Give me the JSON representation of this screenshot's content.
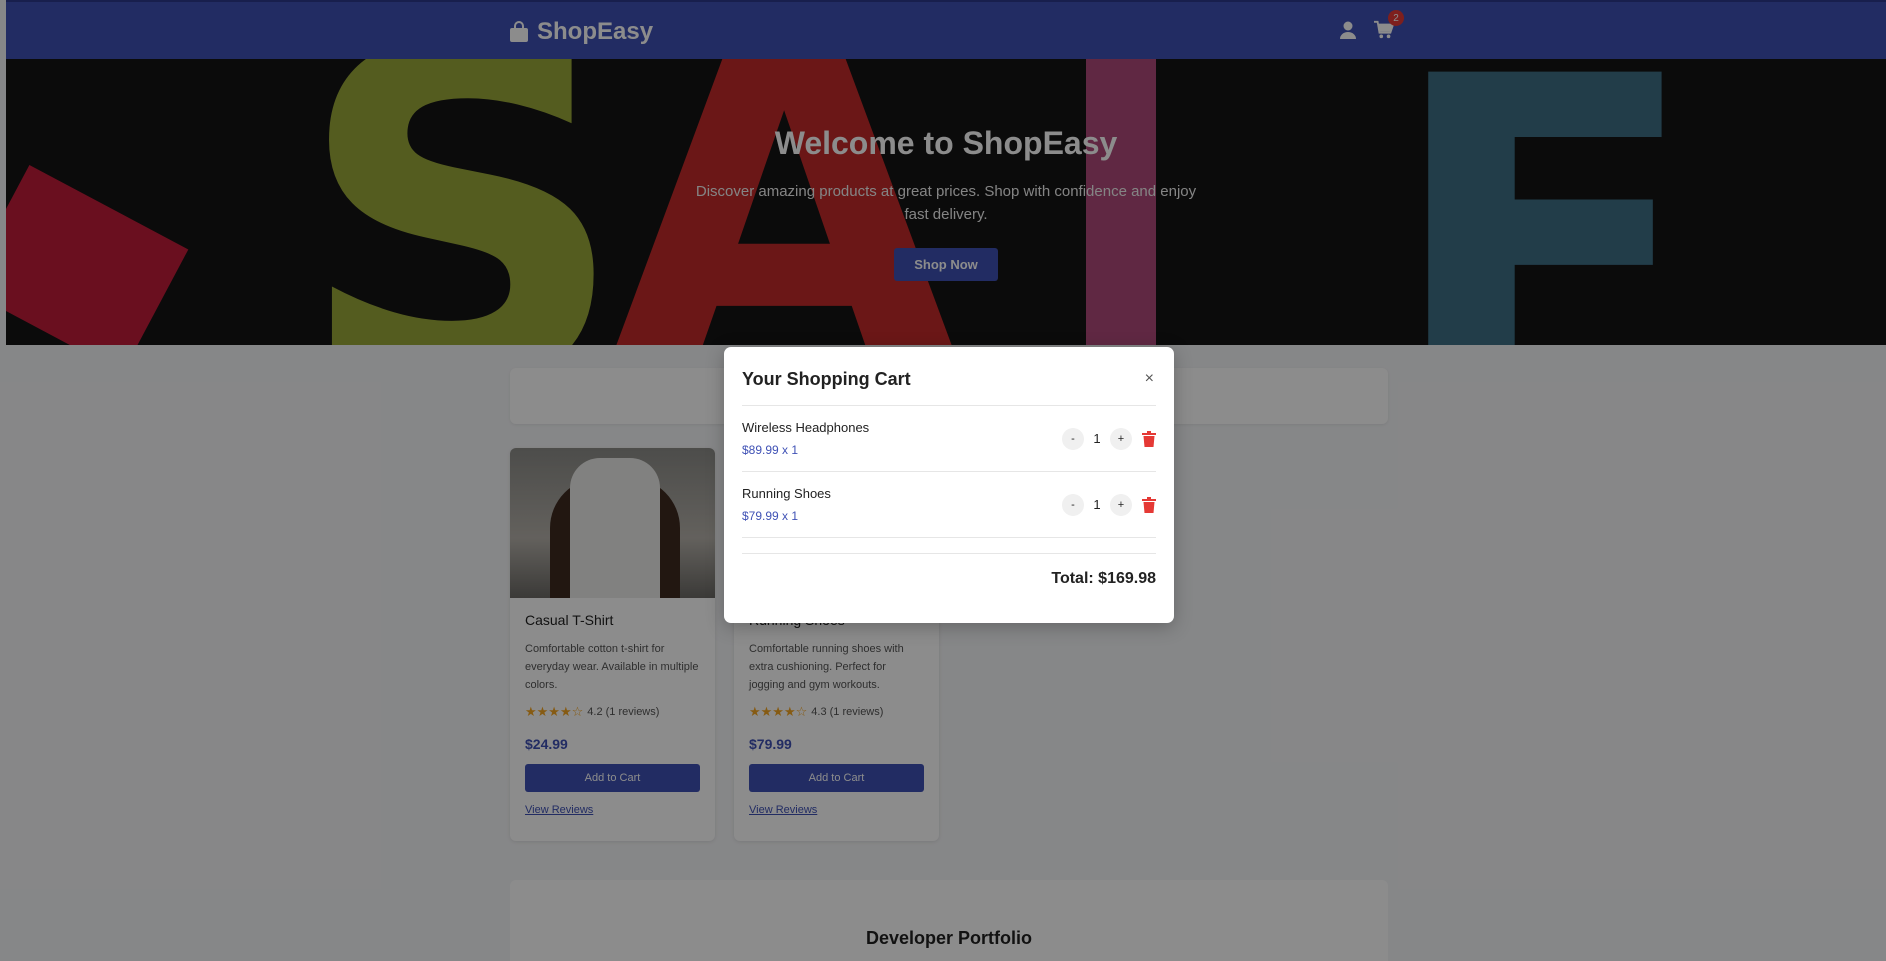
{
  "header": {
    "brand": "ShopEasy",
    "cart_count": "2"
  },
  "hero": {
    "title": "Welcome to ShopEasy",
    "subtitle": "Discover amazing products at great prices. Shop with confidence and enjoy fast delivery.",
    "cta_label": "Shop Now"
  },
  "products": [
    {
      "title": "Casual T-Shirt",
      "description": "Comfortable cotton t-shirt for everyday wear. Available in multiple colors.",
      "rating": "4.2 (1 reviews)",
      "price": "$24.99",
      "add_label": "Add to Cart",
      "reviews_label": "View Reviews"
    },
    {
      "title": "Running Shoes",
      "description": "Comfortable running shoes with extra cushioning. Perfect for jogging and gym workouts.",
      "rating": "4.3 (1 reviews)",
      "price": "$79.99",
      "add_label": "Add to Cart",
      "reviews_label": "View Reviews"
    }
  ],
  "portfolio": {
    "title": "Developer Portfolio"
  },
  "cart_modal": {
    "title": "Your Shopping Cart",
    "close_label": "×",
    "items": [
      {
        "name": "Wireless Headphones",
        "price_line": "$89.99 x 1",
        "qty": "1",
        "minus": "-",
        "plus": "+"
      },
      {
        "name": "Running Shoes",
        "price_line": "$79.99 x 1",
        "qty": "1",
        "minus": "-",
        "plus": "+"
      }
    ],
    "total": "Total: $169.98"
  },
  "colors": {
    "primary": "#3f51b5",
    "danger": "#e53935",
    "star": "#f5a623"
  }
}
